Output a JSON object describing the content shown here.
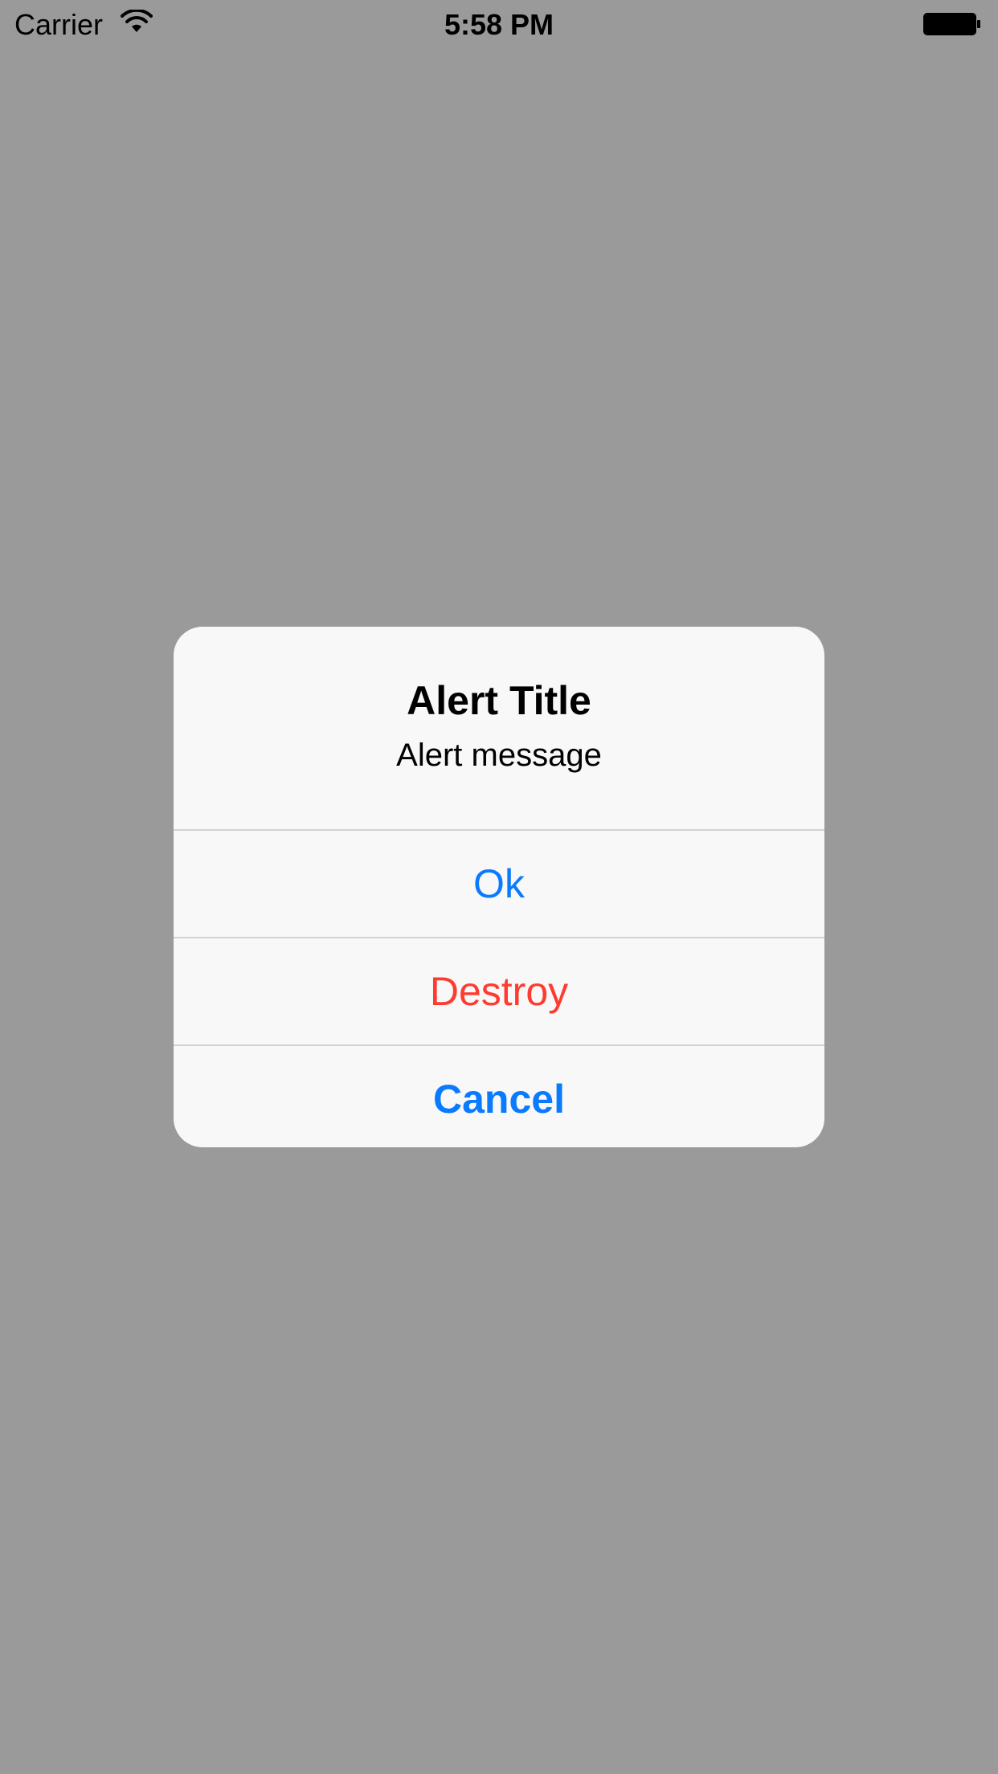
{
  "status_bar": {
    "carrier": "Carrier",
    "time": "5:58 PM",
    "wifi_icon": "wifi-icon",
    "battery_icon": "battery-icon"
  },
  "alert": {
    "title": "Alert Title",
    "message": "Alert message",
    "buttons": [
      {
        "label": "Ok",
        "style": "default"
      },
      {
        "label": "Destroy",
        "style": "destructive"
      },
      {
        "label": "Cancel",
        "style": "cancel"
      }
    ]
  },
  "colors": {
    "overlay": "#9a9a9a",
    "alert_background": "#f8f8f8",
    "accent": "#0a7aff",
    "destructive": "#ff3b30",
    "separator": "#d2d2d2"
  }
}
